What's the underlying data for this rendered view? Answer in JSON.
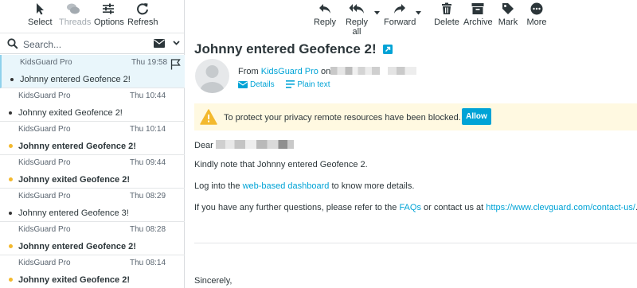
{
  "list_toolbar": {
    "select": "Select",
    "threads": "Threads",
    "options": "Options",
    "refresh": "Refresh"
  },
  "search": {
    "placeholder": "Search..."
  },
  "messages": [
    {
      "from": "KidsGuard Pro",
      "date": "Thu 19:58",
      "subject": "Johnny entered Geofence 2!",
      "unread": false,
      "selected": true
    },
    {
      "from": "KidsGuard Pro",
      "date": "Thu 10:44",
      "subject": "Johnny exited Geofence 2!",
      "unread": false,
      "selected": false
    },
    {
      "from": "KidsGuard Pro",
      "date": "Thu 10:14",
      "subject": "Johnny entered Geofence 2!",
      "unread": true,
      "selected": false
    },
    {
      "from": "KidsGuard Pro",
      "date": "Thu 09:44",
      "subject": "Johnny exited Geofence 2!",
      "unread": true,
      "selected": false
    },
    {
      "from": "KidsGuard Pro",
      "date": "Thu 08:29",
      "subject": "Johnny entered Geofence 3!",
      "unread": false,
      "selected": false
    },
    {
      "from": "KidsGuard Pro",
      "date": "Thu 08:28",
      "subject": "Johnny entered Geofence 2!",
      "unread": true,
      "selected": false
    },
    {
      "from": "KidsGuard Pro",
      "date": "Thu 08:14",
      "subject": "Johnny exited Geofence 2!",
      "unread": true,
      "selected": false
    }
  ],
  "message_toolbar": {
    "reply": "Reply",
    "reply_all": "Reply all",
    "forward": "Forward",
    "delete": "Delete",
    "archive": "Archive",
    "mark": "Mark",
    "more": "More"
  },
  "message": {
    "subject": "Johnny entered Geofence 2!",
    "from_prefix": "From",
    "from_name": "KidsGuard Pro",
    "on_word": "on",
    "details": "Details",
    "plain_text": "Plain text"
  },
  "privacy": {
    "text": "To protect your privacy remote resources have been blocked.",
    "allow": "Allow"
  },
  "body": {
    "greeting": "Dear",
    "line1": "Kindly note that Johnny entered Geofence 2.",
    "line2_pre": "Log into the ",
    "line2_link": "web-based dashboard",
    "line2_post": " to know more details.",
    "line3_pre": "If you have any further questions, please refer to the ",
    "line3_link1": "FAQs",
    "line3_mid": " or contact us at ",
    "line3_link2": "https://www.clevguard.com/contact-us/",
    "line3_post": ".",
    "closing": "Sincerely,"
  },
  "colors": {
    "accent": "#00a3d6",
    "unread_dot": "#f3b92e",
    "selected_bg": "#e9f6fb",
    "warning_bg": "#fff9e1"
  }
}
